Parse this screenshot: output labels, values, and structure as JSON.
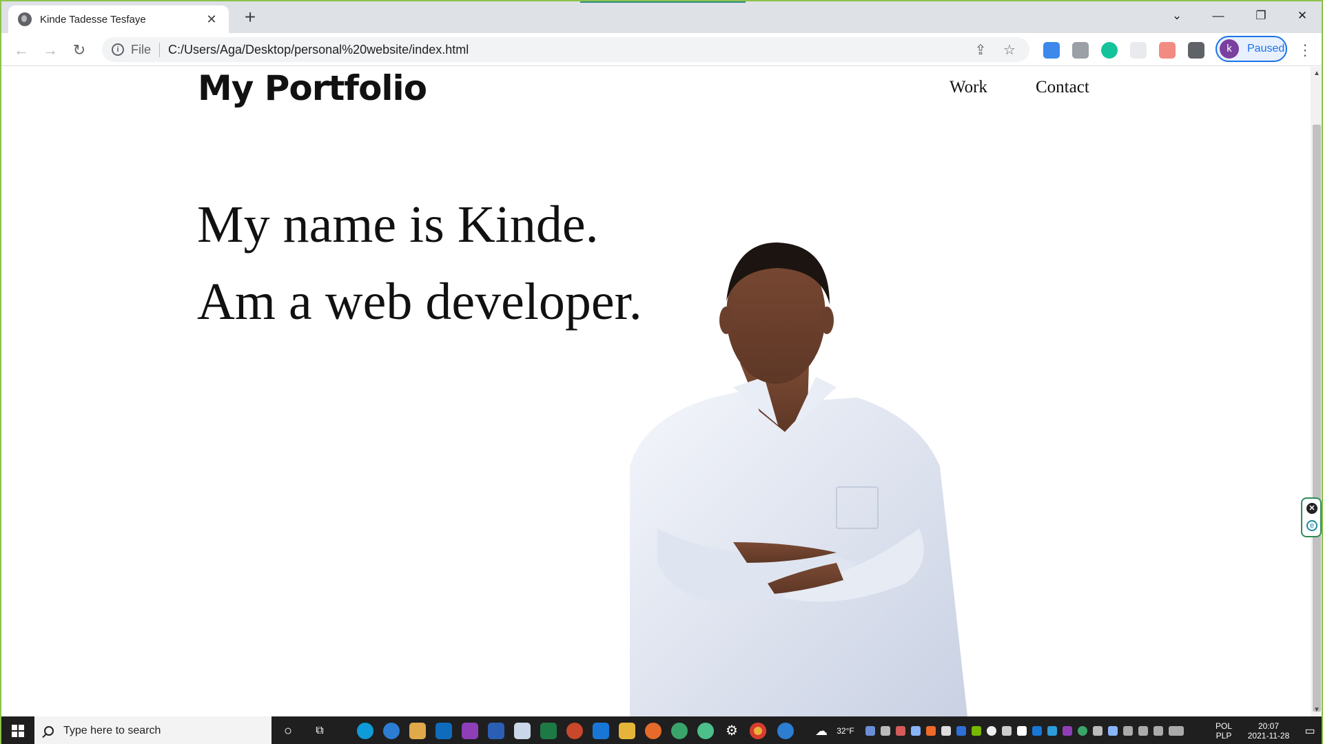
{
  "browser": {
    "tab_title": "Kinde Tadesse Tesfaye",
    "tab_close": "✕",
    "new_tab": "+",
    "url_scheme": "File",
    "url": "C:/Users/Aga/Desktop/personal%20website/index.html",
    "profile_initial": "k",
    "profile_status": "Paused"
  },
  "site": {
    "brand": "My Portfolio",
    "nav": [
      "Work",
      "Contact"
    ],
    "headline_1": "My name is Kinde.",
    "headline_2": "Am a web developer."
  },
  "taskbar": {
    "search_placeholder": "Type here to search",
    "weather": "32°F",
    "lang_1": "POL",
    "lang_2": "PLP",
    "time": "20:07",
    "date": "2021-11-28"
  },
  "colors": {
    "window_border": "#8bc34a",
    "profile_accent": "#1a73e8",
    "taskbar_bg": "#1f1f1f"
  },
  "icons": {
    "tab_favicon": "globe-icon",
    "back": "arrow-left-icon",
    "forward": "arrow-right-icon",
    "reload": "reload-icon",
    "site_info": "info-icon",
    "share": "share-icon",
    "bookmark": "star-icon",
    "extensions": "puzzle-icon",
    "menu": "kebab-menu-icon"
  }
}
